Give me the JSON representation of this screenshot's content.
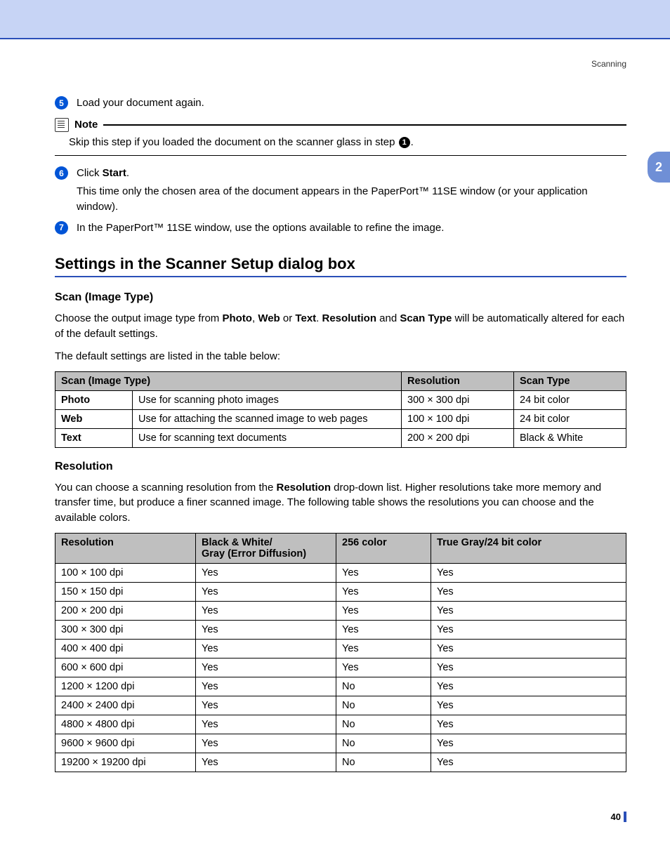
{
  "header": {
    "doc_section": "Scanning"
  },
  "side_tab": "2",
  "page_number": "40",
  "steps": {
    "s5": {
      "num": "5",
      "text": "Load your document again."
    },
    "note": {
      "label": "Note",
      "body_pre": "Skip this step if you loaded the document on the scanner glass in step ",
      "badge": "1",
      "body_post": "."
    },
    "s6": {
      "num": "6",
      "line1_pre": "Click ",
      "line1_bold": "Start",
      "line1_post": ".",
      "line2": "This time only the chosen area of the document appears in the PaperPort™ 11SE window (or your application window)."
    },
    "s7": {
      "num": "7",
      "text": "In the PaperPort™ 11SE window, use the options available to refine the image."
    }
  },
  "section_title": "Settings in the Scanner Setup dialog box",
  "scan_type": {
    "heading": "Scan (Image Type)",
    "p1_pre": "Choose the output image type from ",
    "p1_b1": "Photo",
    "p1_m1": ", ",
    "p1_b2": "Web",
    "p1_m2": " or ",
    "p1_b3": "Text",
    "p1_m3": ". ",
    "p1_b4": "Resolution",
    "p1_m4": " and ",
    "p1_b5": "Scan Type",
    "p1_post": " will be automatically altered for each of the default settings.",
    "p2": "The default settings are listed in the table below:",
    "table": {
      "head": [
        "Scan (Image Type)",
        "Resolution",
        "Scan Type"
      ],
      "rows": [
        {
          "name": "Photo",
          "desc": "Use for scanning photo images",
          "res": "300 × 300 dpi",
          "type": "24 bit color"
        },
        {
          "name": "Web",
          "desc": "Use for attaching the scanned image to web pages",
          "res": "100 × 100 dpi",
          "type": "24 bit color"
        },
        {
          "name": "Text",
          "desc": "Use for scanning text documents",
          "res": "200 × 200 dpi",
          "type": "Black & White"
        }
      ]
    }
  },
  "resolution": {
    "heading": "Resolution",
    "p1_pre": "You can choose a scanning resolution from the ",
    "p1_b1": "Resolution",
    "p1_post": " drop-down list. Higher resolutions take more memory and transfer time, but produce a finer scanned image. The following table shows the resolutions you can choose and the available colors.",
    "table": {
      "head": [
        "Resolution",
        "Black & White/\nGray (Error Diffusion)",
        "256 color",
        "True Gray/24 bit color"
      ],
      "rows": [
        {
          "res": "100 × 100 dpi",
          "bw": "Yes",
          "c256": "Yes",
          "tg": "Yes"
        },
        {
          "res": "150 × 150 dpi",
          "bw": "Yes",
          "c256": "Yes",
          "tg": "Yes"
        },
        {
          "res": "200 × 200 dpi",
          "bw": "Yes",
          "c256": "Yes",
          "tg": "Yes"
        },
        {
          "res": "300 × 300 dpi",
          "bw": "Yes",
          "c256": "Yes",
          "tg": "Yes"
        },
        {
          "res": "400 × 400 dpi",
          "bw": "Yes",
          "c256": "Yes",
          "tg": "Yes"
        },
        {
          "res": "600 × 600 dpi",
          "bw": "Yes",
          "c256": "Yes",
          "tg": "Yes"
        },
        {
          "res": "1200 × 1200 dpi",
          "bw": "Yes",
          "c256": "No",
          "tg": "Yes"
        },
        {
          "res": "2400 × 2400 dpi",
          "bw": "Yes",
          "c256": "No",
          "tg": "Yes"
        },
        {
          "res": "4800 × 4800 dpi",
          "bw": "Yes",
          "c256": "No",
          "tg": "Yes"
        },
        {
          "res": "9600 × 9600 dpi",
          "bw": "Yes",
          "c256": "No",
          "tg": "Yes"
        },
        {
          "res": "19200 × 19200 dpi",
          "bw": "Yes",
          "c256": "No",
          "tg": "Yes"
        }
      ]
    }
  }
}
